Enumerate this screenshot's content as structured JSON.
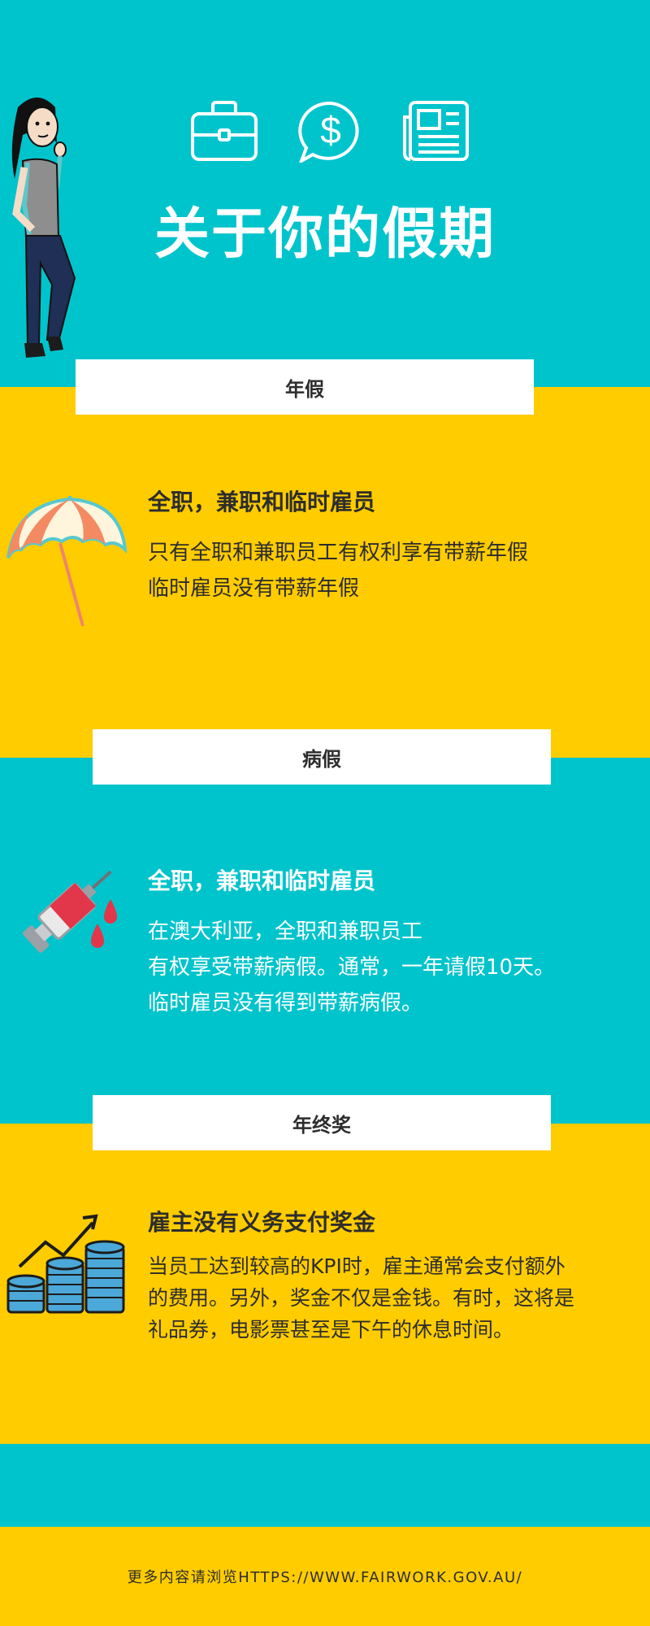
{
  "title": "关于你的假期",
  "icons": [
    "briefcase-icon",
    "dollar-chat-icon",
    "newspaper-icon",
    "woman-thinking-icon",
    "umbrella-icon",
    "syringe-icon",
    "coins-growth-icon"
  ],
  "colors": {
    "teal": "#00c4cc",
    "yellow": "#ffcc00",
    "dark_text": "#2d2d2d",
    "white": "#ffffff"
  },
  "sections": [
    {
      "banner": "年假",
      "heading": "全职，兼职和临时雇员",
      "lines": [
        "只有全职和兼职员工有权利享有带薪年假",
        "临时雇员没有带薪年假"
      ]
    },
    {
      "banner": "病假",
      "heading": "全职，兼职和临时雇员",
      "lines": [
        "在澳大利亚，全职和兼职员工",
        "有权享受带薪病假。通常，一年请假10天。",
        "临时雇员没有得到带薪病假。"
      ]
    },
    {
      "banner": "年终奖",
      "heading": "雇主没有义务支付奖金",
      "lines": [
        "当员工达到较高的KPI时，雇主通常会支付额外",
        "的费用。另外，奖金不仅是金钱。有时，这将是",
        "礼品券，电影票甚至是下午的休息时间。"
      ]
    }
  ],
  "footer": "更多内容请浏览HTTPS://WWW.FAIRWORK.GOV.AU/"
}
